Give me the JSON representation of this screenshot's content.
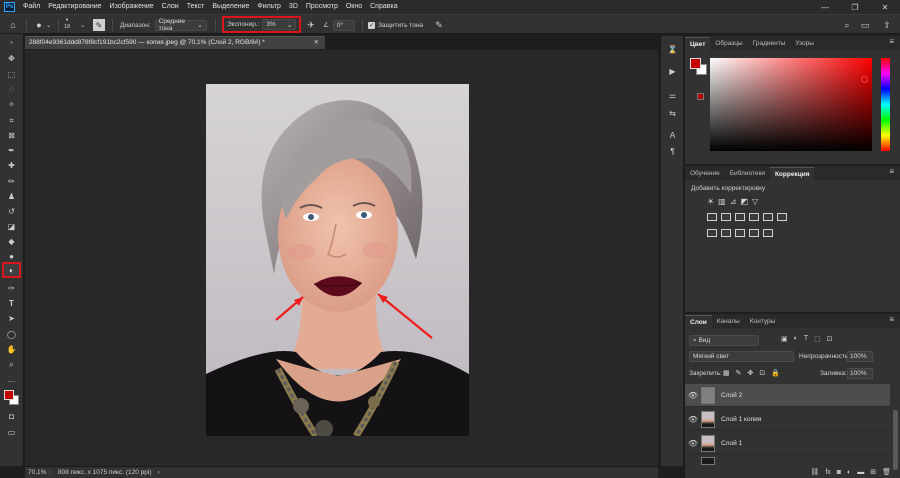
{
  "menubar": {
    "items": [
      "Файл",
      "Редактирование",
      "Изображение",
      "Слои",
      "Текст",
      "Выделение",
      "Фильтр",
      "3D",
      "Просмотр",
      "Окно",
      "Справка"
    ],
    "app_logo": "Ps"
  },
  "options": {
    "brush_size": "18",
    "range_label": "Диапазон:",
    "range_value": "Средние тона",
    "exposure_label": "Экспонир.:",
    "exposure_value": "3%",
    "angle_value": "0°",
    "protect_tones_label": "Защитить тона"
  },
  "document": {
    "tab_title": "288f04e9361ddd878f8cf191bc2cf590 — копия.jpeg @ 70,1% (Слой 2, RGB/8#) *",
    "zoom": "70,1%",
    "status_info": "808 пикс. x 1075 пикс. (120 ppi)"
  },
  "color_panel": {
    "tabs": [
      "Цвет",
      "Образцы",
      "Градиенты",
      "Узоры"
    ],
    "foreground": "#c40000",
    "background": "#ffffff"
  },
  "adjustments_panel": {
    "tabs": [
      "Обучение",
      "Библиотеки",
      "Коррекция"
    ],
    "hint": "Добавить корректировку"
  },
  "layers_panel": {
    "tabs": [
      "Слои",
      "Каналы",
      "Контуры"
    ],
    "filter": "Вид",
    "blend_mode": "Мягкий свет",
    "opacity_label": "Непрозрачность:",
    "opacity_value": "100%",
    "lock_label": "Закрепить:",
    "fill_label": "Заливка:",
    "fill_value": "100%",
    "layers": [
      {
        "name": "Слой 2"
      },
      {
        "name": "Слой 1 копия"
      },
      {
        "name": "Слой 1"
      }
    ]
  },
  "highlight_color": "#d9161c"
}
